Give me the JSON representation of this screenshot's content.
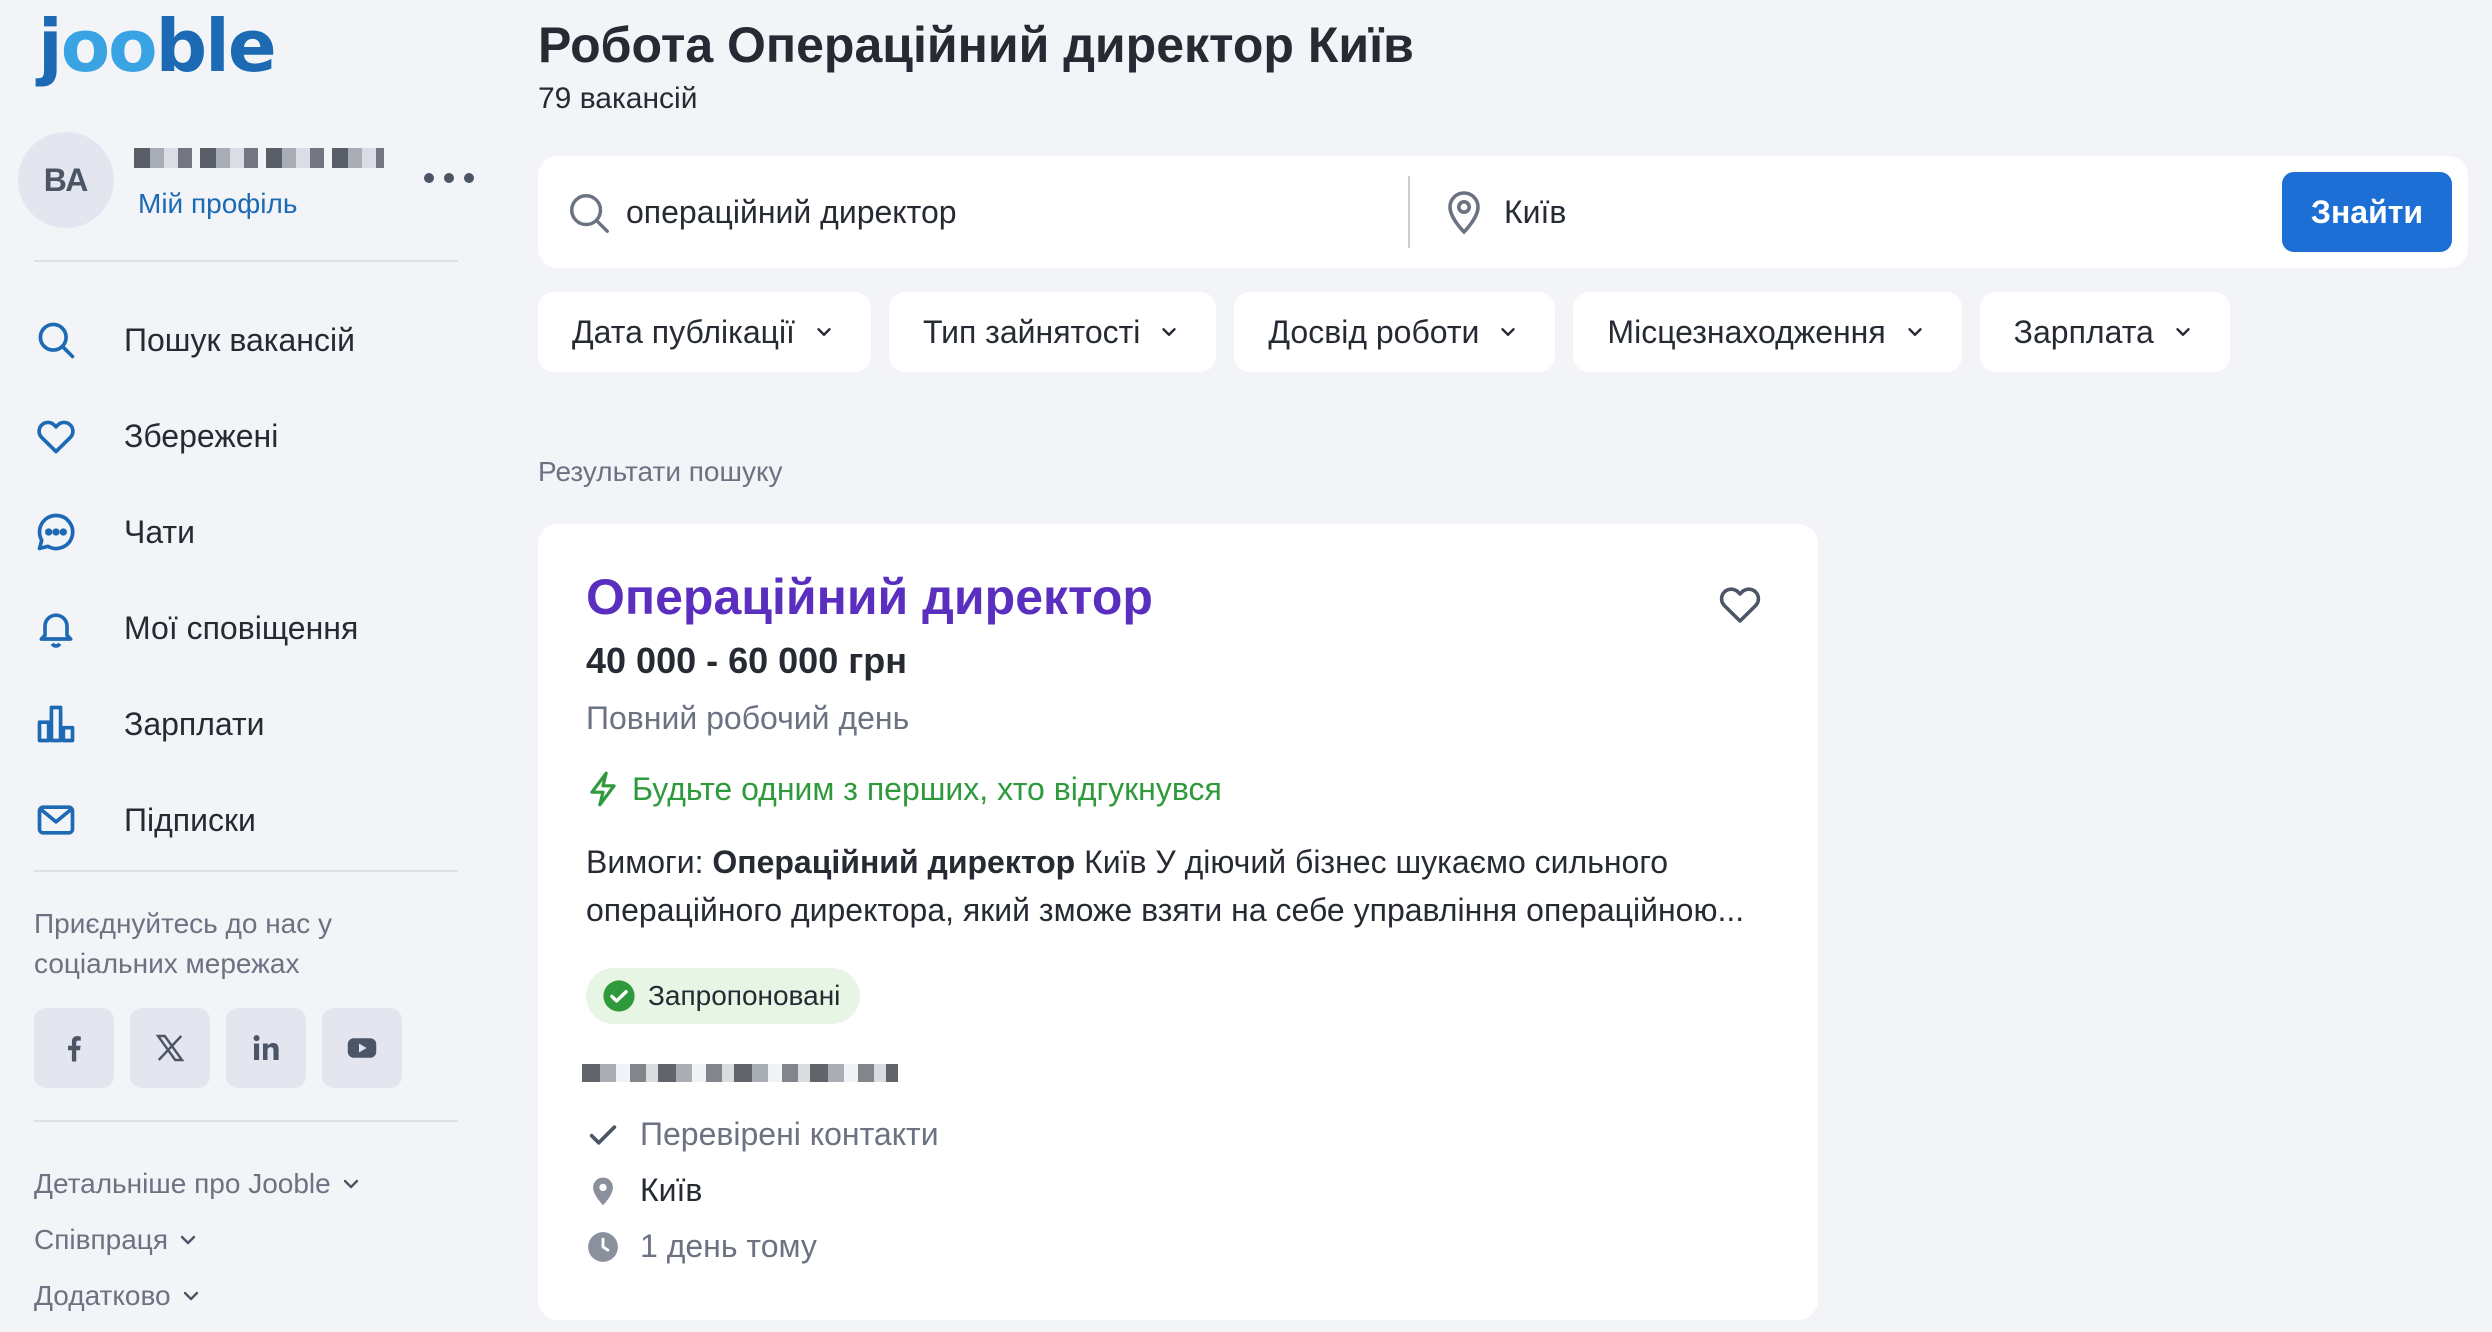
{
  "logo": {
    "text": "jooble"
  },
  "profile": {
    "initials": "ВА",
    "link": "Мій профіль"
  },
  "nav": [
    {
      "label": "Пошук вакансій",
      "icon": "search-icon"
    },
    {
      "label": "Збережені",
      "icon": "heart-icon"
    },
    {
      "label": "Чати",
      "icon": "chat-icon"
    },
    {
      "label": "Мої сповіщення",
      "icon": "bell-icon"
    },
    {
      "label": "Зарплати",
      "icon": "bar-chart-icon"
    },
    {
      "label": "Підписки",
      "icon": "mail-icon"
    }
  ],
  "social": {
    "text": "Приєднуйтесь до нас у соціальних мережах",
    "networks": [
      "facebook-icon",
      "x-icon",
      "linkedin-icon",
      "youtube-icon"
    ]
  },
  "footer": {
    "links": [
      "Детальніше про Jooble",
      "Співпраця",
      "Додатково"
    ]
  },
  "header": {
    "title": "Робота Операційний директор Київ",
    "count": "79 вакансій"
  },
  "search": {
    "query": "операційний директор",
    "location": "Київ",
    "button": "Знайти"
  },
  "filters": [
    "Дата публікації",
    "Тип зайнятості",
    "Досвід роботи",
    "Місцезнаходження",
    "Зарплата"
  ],
  "results_label": "Результати пошуку",
  "job": {
    "title": "Операційний директор",
    "salary": "40 000 - 60 000 грн",
    "schedule": "Повний робочий день",
    "early": "Будьте одним з перших, хто відгукнувся",
    "snippet_prefix": "Вимоги: ",
    "snippet_bold": "Операційний директор",
    "snippet_rest": " Київ У діючий бізнес шукаємо сильного операційного директора, який зможе взяти на себе управління операційною...",
    "badge": "Запропоновані",
    "verified": "Перевірені контакти",
    "location": "Київ",
    "posted": "1 день тому"
  },
  "colors": {
    "brand": "#1d6ab4",
    "button": "#1d6fd6",
    "job_title": "#5a2fbf",
    "green": "#2f9a3c",
    "muted": "#6b7281"
  }
}
